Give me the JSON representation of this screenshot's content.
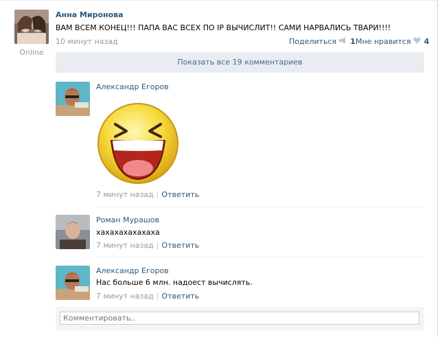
{
  "post": {
    "author": "Анна Миронова",
    "status": "Online",
    "text": "ВАМ ВСЕМ КОНЕЦ!!! ПАПА ВАС ВСЕХ ПО IP ВЫЧИСЛИТ!! САМИ НАРВАЛИСЬ ТВАРИ!!!!",
    "time": "10 минут назад",
    "share_label": "Поделиться",
    "share_count": "1",
    "like_label": "Мне нравится",
    "like_count": "4",
    "show_all": "Показать все 19 комментариев"
  },
  "comments": [
    {
      "author": "Александр Егоров",
      "text": "",
      "sticker": "laughing-smiley",
      "time": "7 минут назад",
      "reply": "Ответить"
    },
    {
      "author": "Роман Мурашов",
      "text": "хахахахахахаха",
      "time": "7 минут назад",
      "reply": "Ответить"
    },
    {
      "author": "Александр Егоров",
      "text": "Нас больше 6 млн. надоест вычислять.",
      "time": "7 минут назад",
      "reply": "Ответить"
    }
  ],
  "composer": {
    "placeholder": "Комментировать.."
  },
  "icons": {
    "share": "megaphone-icon",
    "like": "heart-icon"
  },
  "colors": {
    "link": "#2b587a",
    "muted": "#999999",
    "showall_bg": "#e9edf1",
    "smiley_yellow": "#f6d93a"
  }
}
